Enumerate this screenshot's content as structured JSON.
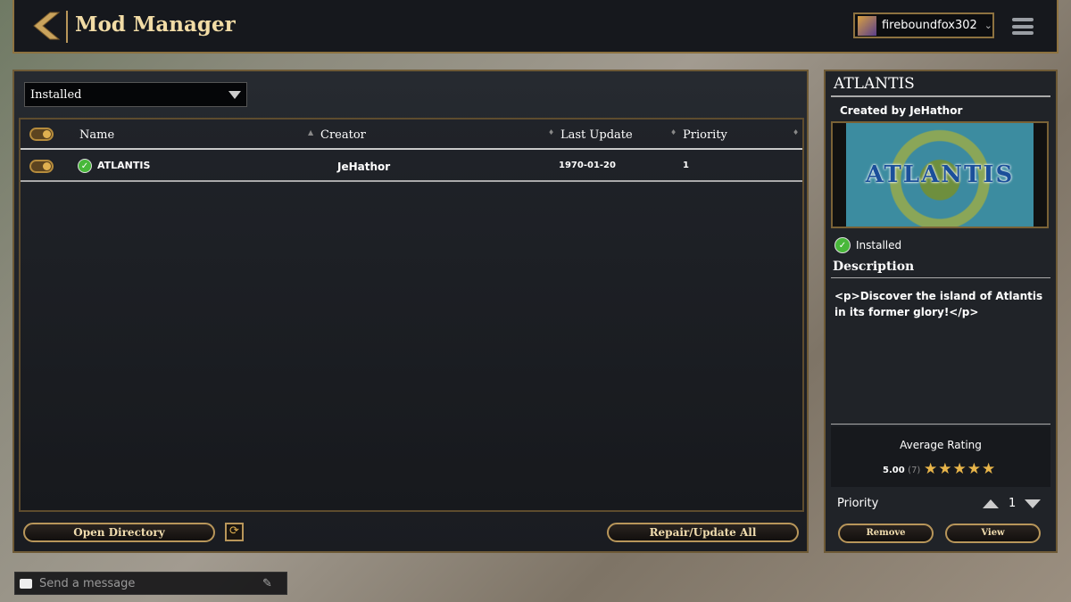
{
  "header": {
    "title": "Mod Manager",
    "username": "fireboundfox302"
  },
  "filter": {
    "selected": "Installed"
  },
  "table": {
    "columns": [
      "Name",
      "Creator",
      "Last Update",
      "Priority"
    ],
    "rows": [
      {
        "name": "ATLANTIS",
        "creator": "JeHathor",
        "last_update": "1970-01-20",
        "priority": "1",
        "enabled": true,
        "installed": true
      }
    ]
  },
  "footer": {
    "open_directory": "Open Directory",
    "repair_update": "Repair/Update All"
  },
  "details": {
    "title": "ATLANTIS",
    "created_by": "Created by JeHathor",
    "banner_text": "ATLANTIS",
    "status": "Installed",
    "description_heading": "Description",
    "description": "<p>Discover the island of Atlantis in its former glory!</p>",
    "rating_label": "Average Rating",
    "rating": "5.00",
    "rating_count": "(7)",
    "stars": 5,
    "priority_label": "Priority",
    "priority": "1",
    "remove": "Remove",
    "view": "View"
  },
  "chat": {
    "placeholder": "Send a message"
  }
}
